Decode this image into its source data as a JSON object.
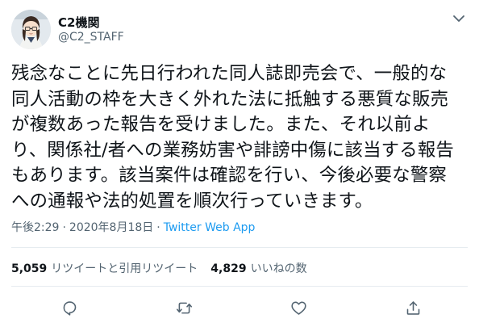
{
  "author": {
    "display_name": "C2機関",
    "handle": "@C2_STAFF",
    "avatar_icon": "avatar-anime-girl-icon"
  },
  "tweet": {
    "text": "残念なことに先日行われた同人誌即売会で、一般的な\n同人活動の枠を大きく外れた法に抵触する悪質な販売\nが複数あった報告を受けました。また、それ以前よ\nり、関係社/者への業務妨害や誹謗中傷に該当する報告\nもあります。該当案件は確認を行い、今後必要な警察\nへの通報や法的処置を順次行っていきます。",
    "time": "午後2:29",
    "date": "2020年8月18日",
    "separator": "·",
    "client": "Twitter Web App"
  },
  "stats": {
    "retweets_count": "5,059",
    "retweets_label": "リツイートと引用リツイート",
    "likes_count": "4,829",
    "likes_label": "いいねの数"
  },
  "actions": [
    "reply-icon",
    "retweet-icon",
    "like-icon",
    "share-icon"
  ],
  "colors": {
    "text": "#0f1419",
    "secondary": "#536471",
    "link": "#1d9bf0",
    "divider": "#e6ecf0"
  }
}
